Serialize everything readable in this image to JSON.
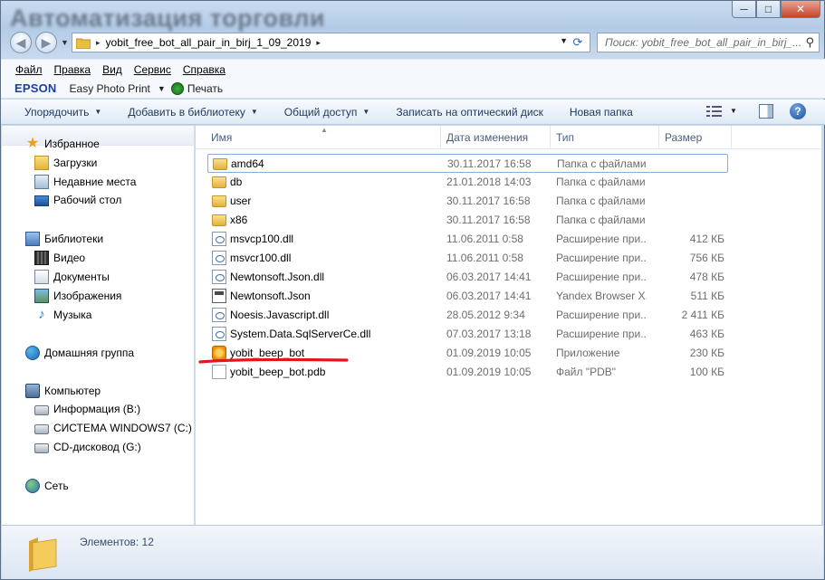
{
  "window": {
    "title_blurred": "Автоматизация торговли",
    "buttons": {
      "minimize": "─",
      "maximize": "□",
      "close": "✕"
    }
  },
  "address_bar": {
    "crumb": "yobit_free_bot_all_pair_in_birj_1_09_2019",
    "separator": "▸",
    "search_placeholder": "Поиск: yobit_free_bot_all_pair_in_birj_..."
  },
  "menu": [
    "Файл",
    "Правка",
    "Вид",
    "Сервис",
    "Справка"
  ],
  "epson_bar": {
    "logo": "EPSON",
    "app": "Easy Photo Print",
    "print": "Печать"
  },
  "command_bar": [
    "Упорядочить",
    "Добавить в библиотеку",
    "Общий доступ",
    "Записать на оптический диск",
    "Новая папка"
  ],
  "navigation": {
    "favorites": {
      "label": "Избранное",
      "items": [
        "Загрузки",
        "Недавние места",
        "Рабочий стол"
      ]
    },
    "libraries": {
      "label": "Библиотеки",
      "items": [
        "Видео",
        "Документы",
        "Изображения",
        "Музыка"
      ]
    },
    "homegroup": "Домашняя группа",
    "computer": {
      "label": "Компьютер",
      "items": [
        "Информация (B:)",
        "СИСТЕМА WINDOWS7 (C:)",
        "CD-дисковод (G:)"
      ]
    },
    "network": "Сеть"
  },
  "columns": {
    "name": "Имя",
    "date": "Дата изменения",
    "type": "Тип",
    "size": "Размер"
  },
  "files": [
    {
      "name": "amd64",
      "date": "30.11.2017 16:58",
      "type": "Папка с файлами",
      "size": "",
      "icon": "folder-icon"
    },
    {
      "name": "db",
      "date": "21.01.2018 14:03",
      "type": "Папка с файлами",
      "size": "",
      "icon": "folder-icon"
    },
    {
      "name": "user",
      "date": "30.11.2017 16:58",
      "type": "Папка с файлами",
      "size": "",
      "icon": "folder-icon"
    },
    {
      "name": "x86",
      "date": "30.11.2017 16:58",
      "type": "Папка с файлами",
      "size": "",
      "icon": "folder-icon"
    },
    {
      "name": "msvcp100.dll",
      "date": "11.06.2011 0:58",
      "type": "Расширение при...",
      "size": "412 КБ",
      "icon": "dll-icon"
    },
    {
      "name": "msvcr100.dll",
      "date": "11.06.2011 0:58",
      "type": "Расширение при...",
      "size": "756 КБ",
      "icon": "dll-icon"
    },
    {
      "name": "Newtonsoft.Json.dll",
      "date": "06.03.2017 14:41",
      "type": "Расширение при...",
      "size": "478 КБ",
      "icon": "dll-icon"
    },
    {
      "name": "Newtonsoft.Json",
      "date": "06.03.2017 14:41",
      "type": "Yandex Browser X...",
      "size": "511 КБ",
      "icon": "xml-doc-icon"
    },
    {
      "name": "Noesis.Javascript.dll",
      "date": "28.05.2012 9:34",
      "type": "Расширение при...",
      "size": "2 411 КБ",
      "icon": "dll-icon"
    },
    {
      "name": "System.Data.SqlServerCe.dll",
      "date": "07.03.2017 13:18",
      "type": "Расширение при...",
      "size": "463 КБ",
      "icon": "dll-icon"
    },
    {
      "name": "yobit_beep_bot",
      "date": "01.09.2019 10:05",
      "type": "Приложение",
      "size": "230 КБ",
      "icon": "application-icon"
    },
    {
      "name": "yobit_beep_bot.pdb",
      "date": "01.09.2019 10:05",
      "type": "Файл \"PDB\"",
      "size": "100 КБ",
      "icon": "file-icon"
    }
  ],
  "status": {
    "items_count": "Элементов: 12"
  },
  "colors": {
    "highlight": "#e3161c",
    "accent": "#1c3e9e"
  }
}
